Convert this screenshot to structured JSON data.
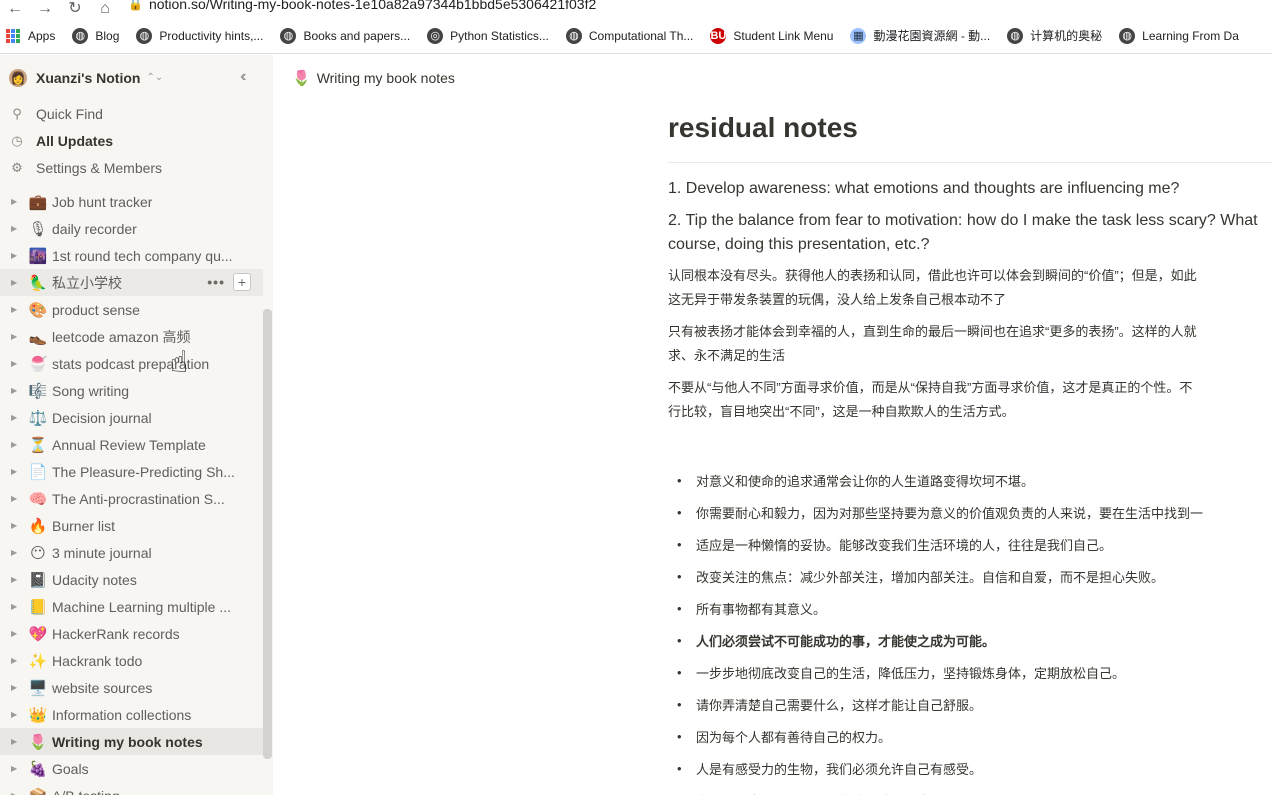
{
  "browser": {
    "url": "notion.so/Writing-my-book-notes-1e10a82a97344b1bbd5e5306421f03f2",
    "bookmarks": [
      {
        "label": "Apps",
        "icon": "apps-grid-icon"
      },
      {
        "label": "Blog",
        "icon": "globe-icon"
      },
      {
        "label": "Productivity hints,...",
        "icon": "globe-icon"
      },
      {
        "label": "Books and papers...",
        "icon": "globe-icon"
      },
      {
        "label": "Python Statistics...",
        "icon": "github-icon"
      },
      {
        "label": "Computational Th...",
        "icon": "globe-icon"
      },
      {
        "label": "Student Link Menu",
        "icon": "bu-logo-icon"
      },
      {
        "label": "動漫花園資源網 - 動...",
        "icon": "dmhy-icon"
      },
      {
        "label": "计算机的奥秘",
        "icon": "globe-icon"
      },
      {
        "label": "Learning From Da",
        "icon": "globe-icon"
      }
    ]
  },
  "sidebar": {
    "workspace_name": "Xuanzi's Notion",
    "top_items": [
      {
        "label": "Quick Find",
        "icon": "search-icon",
        "glyph": "⚲"
      },
      {
        "label": "All Updates",
        "icon": "clock-icon",
        "glyph": "◷"
      },
      {
        "label": "Settings & Members",
        "icon": "gear-icon",
        "glyph": "⚙"
      }
    ],
    "pages": [
      {
        "label": "Job hunt tracker",
        "emoji": "💼"
      },
      {
        "label": "daily recorder",
        "emoji": "🎙"
      },
      {
        "label": "1st round tech company qu...",
        "emoji": "🌆"
      },
      {
        "label": "私立小学校",
        "emoji": "🦜"
      },
      {
        "label": "product sense",
        "emoji": "🎨"
      },
      {
        "label": "leetcode amazon 高频",
        "emoji": "👞"
      },
      {
        "label": "stats podcast preparation",
        "emoji": "🍧"
      },
      {
        "label": "Song writing",
        "emoji": "🎼"
      },
      {
        "label": "Decision journal",
        "emoji": "⚖️"
      },
      {
        "label": "Annual Review Template",
        "emoji": "⏳"
      },
      {
        "label": "The Pleasure-Predicting Sh...",
        "emoji": "📄"
      },
      {
        "label": "The Anti-procrastination S...",
        "emoji": "🧠"
      },
      {
        "label": "Burner list",
        "emoji": "🔥"
      },
      {
        "label": "3 minute journal",
        "emoji": "😶"
      },
      {
        "label": "Udacity notes",
        "emoji": "📓"
      },
      {
        "label": "Machine Learning multiple ...",
        "emoji": "📒"
      },
      {
        "label": "HackerRank records",
        "emoji": "💖"
      },
      {
        "label": "Hackrank todo",
        "emoji": "✨"
      },
      {
        "label": "website sources",
        "emoji": "🖥️"
      },
      {
        "label": "Information collections",
        "emoji": "👑"
      },
      {
        "label": "Writing my book notes",
        "emoji": "🌷"
      },
      {
        "label": "Goals",
        "emoji": "🍇"
      },
      {
        "label": "A/B testing",
        "emoji": "📦"
      }
    ]
  },
  "topbar": {
    "breadcrumb": "Writing my book notes",
    "emoji": "🌷"
  },
  "page": {
    "title": "residual notes",
    "paragraphs": [
      "1. Develop awareness: what emotions and thoughts are influencing me?",
      "2. Tip the balance from fear to motivation: how do I make the task less scary? What",
      "course, doing this presentation, etc.?"
    ],
    "zh_paragraphs": [
      [
        "认同根本没有尽头。获得他人的表扬和认同，借此也许可以体会到瞬间的“价值”；但是，如此",
        "这无异于带发条装置的玩偶，没人给上发条自己根本动不了"
      ],
      [
        "只有被表扬才能体会到幸福的人，直到生命的最后一瞬间也在追求“更多的表扬”。这样的人就",
        "求、永不满足的生活"
      ],
      [
        "不要从“与他人不同”方面寻求价值，而是从“保持自我”方面寻求价值，这才是真正的个性。不",
        "行比较，盲目地突出“不同”，这是一种自欺欺人的生活方式。"
      ]
    ],
    "bullets": [
      {
        "text": "对意义和使命的追求通常会让你的人生道路变得坎坷不堪。",
        "bold": false
      },
      {
        "text": "你需要耐心和毅力，因为对那些坚持要为意义的价值观负责的人来说，要在生活中找到一",
        "bold": false
      },
      {
        "text": "适应是一种懒惰的妥协。能够改变我们生活环境的人，往往是我们自己。",
        "bold": false
      },
      {
        "text": "改变关注的焦点：减少外部关注，增加内部关注。自信和自爱，而不是担心失败。",
        "bold": false
      },
      {
        "text": "所有事物都有其意义。",
        "bold": false
      },
      {
        "text": "人们必须尝试不可能成功的事，才能使之成为可能。",
        "bold": true
      },
      {
        "text": "一步步地彻底改变自己的生活，降低压力，坚持锻炼身体，定期放松自己。",
        "bold": false
      },
      {
        "text": "请你弄清楚自己需要什么，这样才能让自己舒服。",
        "bold": false
      },
      {
        "text": "因为每个人都有善待自己的权力。",
        "bold": false
      },
      {
        "text": "人是有感受力的生物，我们必须允许自己有感受。",
        "bold": false
      },
      {
        "text": "未经你同意，任何人都不能让你感到不患",
        "bold": false
      }
    ]
  }
}
